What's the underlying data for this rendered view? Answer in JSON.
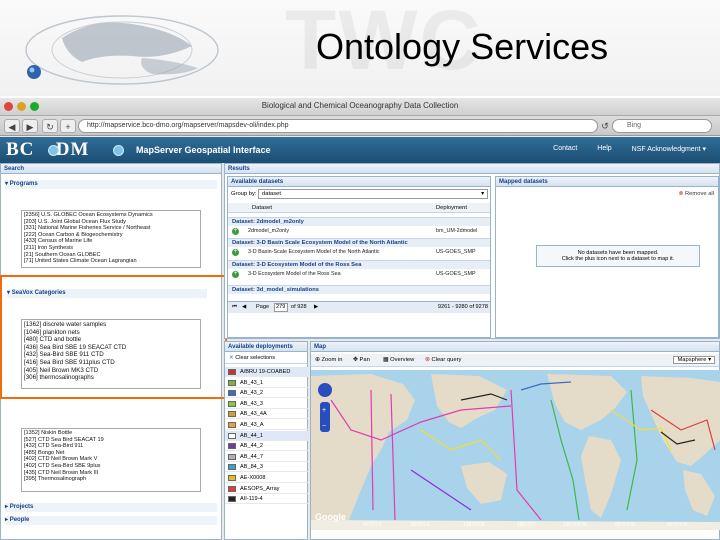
{
  "slide": {
    "title": "Ontology Services",
    "watermark": "TWC"
  },
  "window": {
    "title": "Biological and Chemical Oceanography Data Collection",
    "url": "http://mapservice.bco-dmo.org/mapserver/mapsdev-oli/index.php",
    "search_placeholder": "Bing"
  },
  "app": {
    "logo_left": "BC",
    "logo_right": "-DM",
    "name": "MapServer Geospatial Interface",
    "links": [
      "Contact",
      "Help",
      "NSF Acknowledgment ▾"
    ]
  },
  "search_panel": {
    "title": "Search",
    "programs": {
      "label": "Programs",
      "items": [
        "[2356] U.S. GLOBEC Ocean Ecosystems Dynamics",
        "[203] U.S. Joint Global Ocean Flux Study",
        "[331] National Marine Fisheries Service / Northeast",
        "[222] Ocean Carbon & Biogeochemistry",
        "[433] Census of Marine Life",
        "[211] Iron Synthesis",
        "[21] Southern Ocean GLOBEC",
        "[71] United States Climate Ocean Lagrangian"
      ]
    },
    "seavox": {
      "label": "SeaVox Categories",
      "items": [
        "[1362] discrete water samples",
        "[1046] plankton nets",
        "[480] CTD and bottle",
        "[436] Sea Bird SBE 19 SEACAT CTD",
        "[432] Sea-Bird SBE 911 CTD",
        "[416] Sea Bird SBE 911plus CTD",
        "[405] Neil Brown MK3 CTD",
        "[306] thermosalinographs"
      ]
    },
    "instruments": {
      "items": [
        "[1352] Niskin Bottle",
        "[527] CTD Sea Bird SEACAT 19",
        "[432] CTD Sea-Bird 911",
        "[485] Bongo Net",
        "[402] CTD Neil Brown Mark V",
        "[402] CTD Sea-Bird SBE 9plus",
        "[435] CTD Neil Brown Mark III",
        "[395] Thermosalinograph"
      ]
    },
    "sections": [
      "Projects",
      "People"
    ]
  },
  "results": {
    "title": "Results",
    "available_label": "Available datasets",
    "group_by_label": "Group by:",
    "group_by_value": "dataset",
    "columns": [
      "Dataset",
      "Deployment"
    ],
    "groups": [
      {
        "title": "Dataset: 2dmodel_m2only",
        "rows": [
          {
            "dataset": "2dmodel_m2only",
            "deployment": "bm_UM-2dmodel"
          }
        ]
      },
      {
        "title": "Dataset: 3-D Basin Scale Ecosystem Model of the North Atlantic",
        "rows": [
          {
            "dataset": "3-D Basin-Scale Ecosystem Model of the North Atlantic",
            "deployment": "US-GOES_SMP"
          }
        ]
      },
      {
        "title": "Dataset: 3-D Ecosystem Model of the Ross Sea",
        "rows": [
          {
            "dataset": "3-D Ecosystem Model of the Ross Sea",
            "deployment": "US-GOES_SMP"
          }
        ]
      },
      {
        "title": "Dataset: 3d_model_simulations",
        "rows": []
      }
    ],
    "pager": {
      "page_label": "Page",
      "page": "279",
      "of": "of 928",
      "info": "9261 - 9280 of 9278"
    },
    "mapped_label": "Mapped datasets",
    "remove_all": "Remove all",
    "no_datasets_line1": "No datasets have been mapped.",
    "no_datasets_line2": "Click the plus icon next to a dataset to map it."
  },
  "deployments": {
    "title": "Available deployments",
    "clear": "Clear selections",
    "items": [
      {
        "name": "A/BRU 19-COABED",
        "color": "#c0392b",
        "selected": true
      },
      {
        "name": "AB_43_1",
        "color": "#7db343",
        "selected": false
      },
      {
        "name": "AB_43_2",
        "color": "#3a6cc8",
        "selected": false
      },
      {
        "name": "AB_43_3",
        "color": "#8dc63f",
        "selected": false
      },
      {
        "name": "AB_43_4A",
        "color": "#c9a23b",
        "selected": false
      },
      {
        "name": "AB_43_A",
        "color": "#e8a23a",
        "selected": false
      },
      {
        "name": "AB_44_1",
        "color": "#ffffff",
        "selected": true
      },
      {
        "name": "AB_44_2",
        "color": "#6b3fa0",
        "selected": false
      },
      {
        "name": "AB_44_7",
        "color": "#b0b0b0",
        "selected": false
      },
      {
        "name": "AB_84_3",
        "color": "#3aa0d0",
        "selected": false
      },
      {
        "name": "AE-X0008",
        "color": "#e0c030",
        "selected": false
      },
      {
        "name": "AESOPS_Array",
        "color": "#e23c3c",
        "selected": false
      },
      {
        "name": "AII-119-4",
        "color": "#222222",
        "selected": false
      }
    ]
  },
  "map": {
    "title": "Map",
    "tools": [
      "Zoom in",
      "Pan",
      "Overview",
      "Clear query"
    ],
    "basemap": "Mapsphere",
    "provider": "Google",
    "longitudes": [
      "45°0'0\"E",
      "90°0'0\"E",
      "135°0'0\"E",
      "180°0'0\"",
      "135°0'0\"W",
      "90°0'0\"W",
      "45°0'0\"W"
    ]
  }
}
